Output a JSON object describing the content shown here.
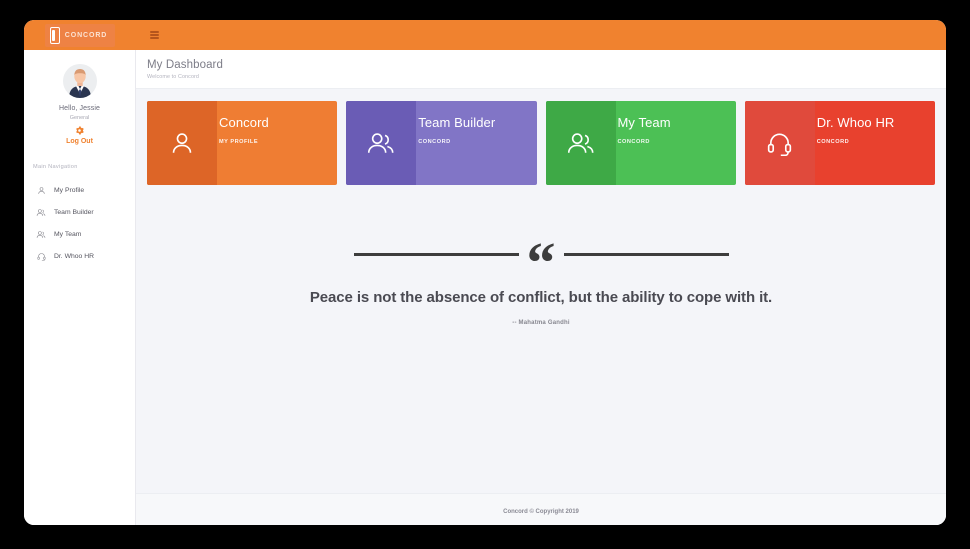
{
  "brand": {
    "name": "CONCORD",
    "logo_icon": "book-mark-icon",
    "menu_icon": "hamburger-menu-icon"
  },
  "sidebar": {
    "avatar_icon": "user-avatar-photo",
    "greeting": "Hello, Jessie",
    "role": "General",
    "settings_icon": "gear-icon",
    "logout_label": "Log Out",
    "nav_section_title": "Main Navigation",
    "items": [
      {
        "label": "My Profile",
        "icon": "user-icon"
      },
      {
        "label": "Team Builder",
        "icon": "users-icon"
      },
      {
        "label": "My Team",
        "icon": "users-icon"
      },
      {
        "label": "Dr. Whoo HR",
        "icon": "headset-icon"
      }
    ]
  },
  "header": {
    "title": "My Dashboard",
    "subtitle": "Welcome to Concord"
  },
  "cards": [
    {
      "title": "Concord",
      "subtitle": "MY PROFILE",
      "icon": "user-icon",
      "color": "#ef7d33",
      "icon_pane_color": "#dd6527"
    },
    {
      "title": "Team Builder",
      "subtitle": "CONCORD",
      "icon": "users-icon",
      "color": "#8175c6",
      "icon_pane_color": "#6a5cb5"
    },
    {
      "title": "My Team",
      "subtitle": "CONCORD",
      "icon": "users-icon",
      "color": "#4cc濃"
    }
  ],
  "cards_fixed": [
    {
      "title": "Concord",
      "subtitle": "MY PROFILE",
      "icon": "user-icon",
      "color": "#ef7d33",
      "icon_pane_color": "#dd6527"
    },
    {
      "title": "Team Builder",
      "subtitle": "CONCORD",
      "icon": "users-icon",
      "color": "#8175c6",
      "icon_pane_color": "#6a5cb5"
    },
    {
      "title": "My Team",
      "subtitle": "CONCORD",
      "icon": "users-icon",
      "color": "#4cc055",
      "icon_pane_color": "#3ea946"
    },
    {
      "title": "Dr. Whoo HR",
      "subtitle": "CONCORD",
      "icon": "headset-icon",
      "color": "#e8412e",
      "icon_pane_color": "#e04a3c"
    }
  ],
  "quote": {
    "mark": "“",
    "text": "Peace is not the absence of conflict, but the ability to cope with it.",
    "author": "-- Mahatma Gandhi"
  },
  "footer": {
    "text": "Concord © Copyright 2019"
  },
  "colors": {
    "brand_orange": "#f0822f",
    "accent": "#f0822f",
    "content_bg": "#f4f5f9"
  }
}
